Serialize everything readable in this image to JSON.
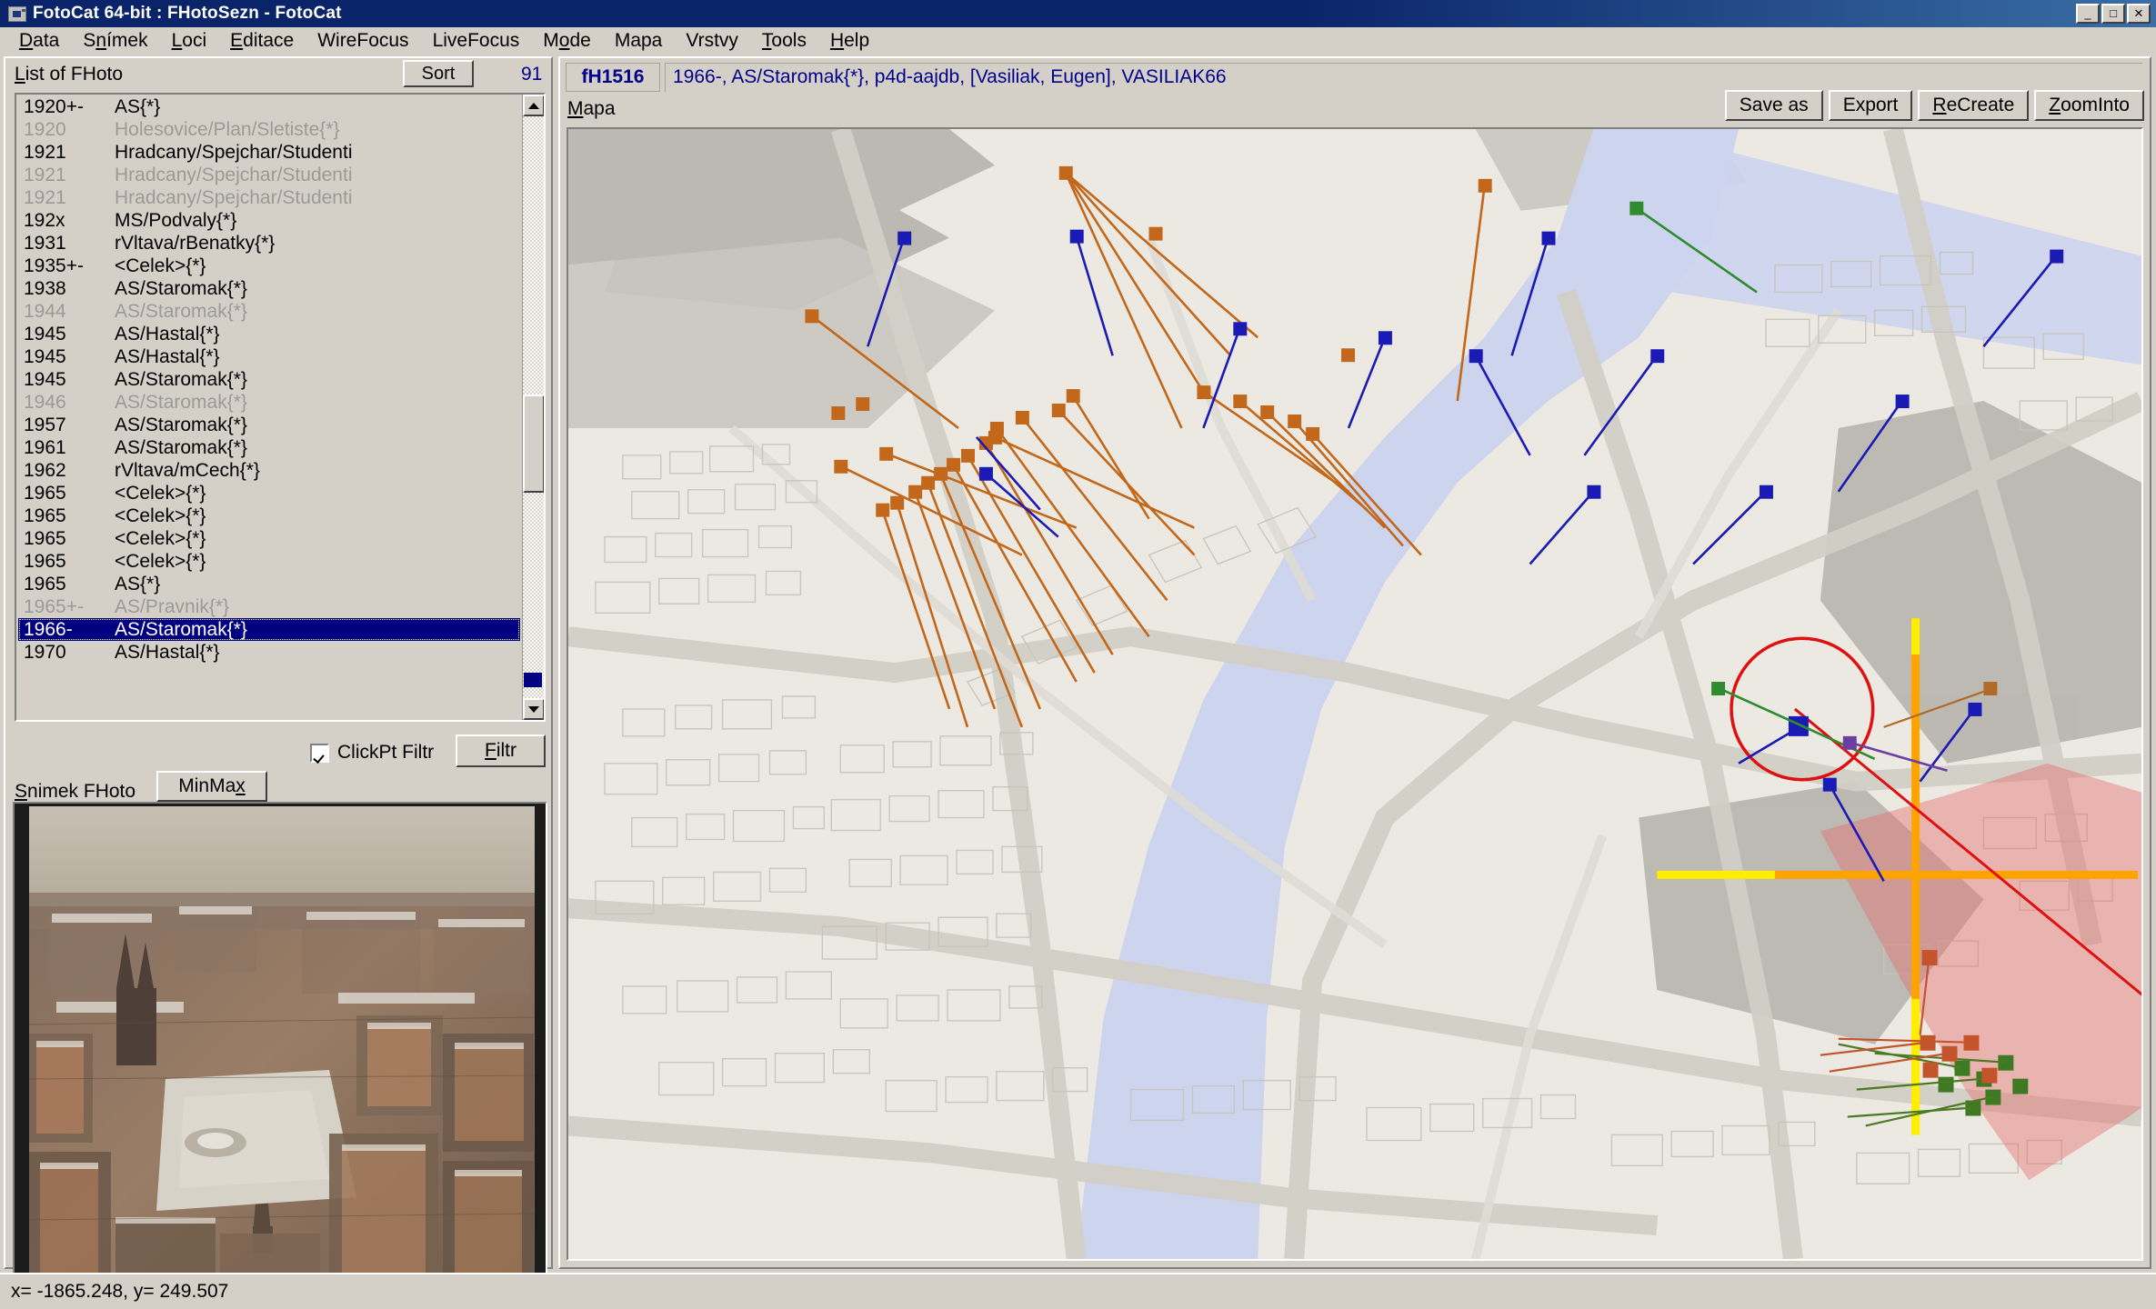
{
  "window": {
    "title": "FotoCat 64-bit : FHotoSezn - FotoCat",
    "icon": "camera-icon",
    "minimize_label": "_",
    "maximize_label": "□",
    "close_label": "✕"
  },
  "menubar": {
    "items": [
      {
        "label": "Data",
        "accel": "D"
      },
      {
        "label": "Snímek",
        "accel": "n"
      },
      {
        "label": "Loci",
        "accel": "L"
      },
      {
        "label": "Editace",
        "accel": "E"
      },
      {
        "label": "WireFocus",
        "accel": ""
      },
      {
        "label": "LiveFocus",
        "accel": ""
      },
      {
        "label": "Mode",
        "accel": "o"
      },
      {
        "label": "Mapa",
        "accel": ""
      },
      {
        "label": "Vrstvy",
        "accel": ""
      },
      {
        "label": "Tools",
        "accel": "T"
      },
      {
        "label": "Help",
        "accel": "H"
      }
    ]
  },
  "left_panel": {
    "list_label": "List of FHoto",
    "list_label_accel": "L",
    "sort_button": "Sort",
    "count": "91",
    "rows": [
      {
        "year": "1920+-",
        "name": "AS{*}",
        "state": "normal"
      },
      {
        "year": "1920",
        "name": "Holesovice/Plan/Sletiste{*}",
        "state": "dim"
      },
      {
        "year": "1921",
        "name": "Hradcany/Spejchar/Studenti",
        "state": "normal"
      },
      {
        "year": "1921",
        "name": "Hradcany/Spejchar/Studenti",
        "state": "dim"
      },
      {
        "year": "1921",
        "name": "Hradcany/Spejchar/Studenti",
        "state": "dim"
      },
      {
        "year": "192x",
        "name": "MS/Podvaly{*}",
        "state": "normal"
      },
      {
        "year": "1931",
        "name": "rVltava/rBenatky{*}",
        "state": "normal"
      },
      {
        "year": "1935+-",
        "name": "<Celek>{*}",
        "state": "normal"
      },
      {
        "year": "1938",
        "name": "AS/Staromak{*}",
        "state": "normal"
      },
      {
        "year": "1944",
        "name": "AS/Staromak{*}",
        "state": "dim"
      },
      {
        "year": "1945",
        "name": "AS/Hastal{*}",
        "state": "normal"
      },
      {
        "year": "1945",
        "name": "AS/Hastal{*}",
        "state": "normal"
      },
      {
        "year": "1945",
        "name": "AS/Staromak{*}",
        "state": "normal"
      },
      {
        "year": "1946",
        "name": "AS/Staromak{*}",
        "state": "dim"
      },
      {
        "year": "1957",
        "name": "AS/Staromak{*}",
        "state": "normal"
      },
      {
        "year": "1961",
        "name": "AS/Staromak{*}",
        "state": "normal"
      },
      {
        "year": "1962",
        "name": "rVltava/mCech{*}",
        "state": "normal"
      },
      {
        "year": "1965",
        "name": "<Celek>{*}",
        "state": "normal"
      },
      {
        "year": "1965",
        "name": "<Celek>{*}",
        "state": "normal"
      },
      {
        "year": "1965",
        "name": "<Celek>{*}",
        "state": "normal"
      },
      {
        "year": "1965",
        "name": "<Celek>{*}",
        "state": "normal"
      },
      {
        "year": "1965",
        "name": "AS{*}",
        "state": "normal"
      },
      {
        "year": "1965+-",
        "name": "AS/Pravnik{*}",
        "state": "dim"
      },
      {
        "year": "1966-",
        "name": "AS/Staromak{*}",
        "state": "selected"
      },
      {
        "year": "1970",
        "name": "AS/Hastal{*}",
        "state": "normal"
      }
    ],
    "clickpt_filtr_label": "ClickPt Filtr",
    "clickpt_filtr_checked": true,
    "filtr_button": "Filtr",
    "filtr_button_accel": "F",
    "snimek_label": "Snimek FHoto",
    "snimek_label_accel": "S",
    "minmax_button": "MinMax",
    "minmax_button_accel": "x",
    "photo_caption": "aerial view of Prague Old Town Square in winter"
  },
  "right_panel": {
    "record_id": "fH1516",
    "record_description": "1966-, AS/Staromak{*}, p4d-aajdb, [Vasiliak, Eugen], VASILIAK66",
    "map_label": "Mapa",
    "map_label_accel": "M",
    "buttons": [
      {
        "label": "Save as",
        "accel": ""
      },
      {
        "label": "Export",
        "accel": ""
      },
      {
        "label": "ReCreate",
        "accel": "R"
      },
      {
        "label": "ZoomInto",
        "accel": "Z"
      }
    ]
  },
  "statusbar": {
    "coords": "x= -1865.248, y= 249.507"
  },
  "colors": {
    "titlebar": "#0a246a",
    "face": "#d4d0c8",
    "selection": "#000080",
    "link_text": "#00008b",
    "marker_orange": "#c3671a",
    "marker_blue": "#1a1ab4",
    "marker_green": "#2e8b2e",
    "marker_purple": "#6a3fa0",
    "view_cone": "#e87070",
    "crosshair_orange": "#ff9a00",
    "crosshair_yellow": "#ffee00",
    "highlight_circle": "#e01010",
    "map_background": "#ebe9e2",
    "water": "#ccd4ee",
    "road": "#d8d6cf"
  }
}
